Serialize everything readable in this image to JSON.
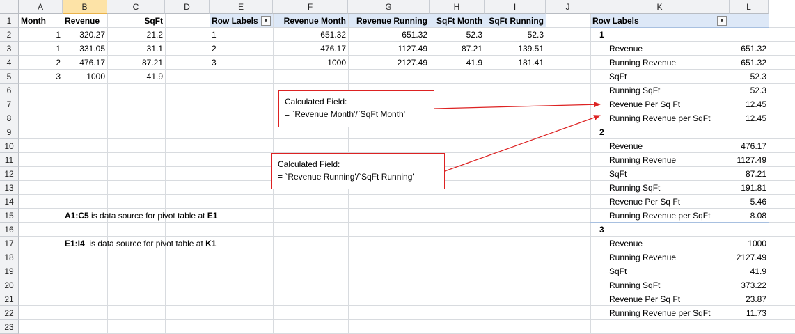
{
  "columns": [
    "A",
    "B",
    "C",
    "D",
    "E",
    "F",
    "G",
    "H",
    "I",
    "J",
    "K",
    "L"
  ],
  "rows": [
    "1",
    "2",
    "3",
    "4",
    "5",
    "6",
    "7",
    "8",
    "9",
    "10",
    "11",
    "12",
    "13",
    "14",
    "15",
    "16",
    "17",
    "18",
    "19",
    "20",
    "21",
    "22",
    "23"
  ],
  "source": {
    "headers": [
      "Month",
      "Revenue",
      "SqFt"
    ],
    "data": [
      [
        "1",
        "320.27",
        "21.2"
      ],
      [
        "1",
        "331.05",
        "31.1"
      ],
      [
        "2",
        "476.17",
        "87.21"
      ],
      [
        "3",
        "1000",
        "41.9"
      ]
    ]
  },
  "pivot1": {
    "headers": [
      "Row Labels",
      "Revenue Month",
      "Revenue Running",
      "SqFt Month",
      "SqFt Running"
    ],
    "dropdown_icon": "filter-dropdown-icon",
    "data": [
      [
        "1",
        "651.32",
        "651.32",
        "52.3",
        "52.3"
      ],
      [
        "2",
        "476.17",
        "1127.49",
        "87.21",
        "139.51"
      ],
      [
        "3",
        "1000",
        "2127.49",
        "41.9",
        "181.41"
      ]
    ]
  },
  "pivot2": {
    "header": "Row Labels",
    "dropdown_icon": "filter-dropdown-icon",
    "groups": [
      {
        "label": "1",
        "items": [
          [
            "Revenue",
            "651.32"
          ],
          [
            "Running Revenue",
            "651.32"
          ],
          [
            "SqFt",
            "52.3"
          ],
          [
            "Running SqFt",
            "52.3"
          ],
          [
            "Revenue Per Sq Ft",
            "12.45"
          ],
          [
            "Running Revenue per SqFt",
            "12.45"
          ]
        ]
      },
      {
        "label": "2",
        "items": [
          [
            "Revenue",
            "476.17"
          ],
          [
            "Running Revenue",
            "1127.49"
          ],
          [
            "SqFt",
            "87.21"
          ],
          [
            "Running SqFt",
            "191.81"
          ],
          [
            "Revenue Per Sq Ft",
            "5.46"
          ],
          [
            "Running Revenue per SqFt",
            "8.08"
          ]
        ]
      },
      {
        "label": "3",
        "items": [
          [
            "Revenue",
            "1000"
          ],
          [
            "Running Revenue",
            "2127.49"
          ],
          [
            "SqFt",
            "41.9"
          ],
          [
            "Running SqFt",
            "373.22"
          ],
          [
            "Revenue Per Sq Ft",
            "23.87"
          ],
          [
            "Running Revenue per SqFt",
            "11.73"
          ]
        ]
      }
    ]
  },
  "notes": {
    "note1": {
      "range": "A1:C5",
      "mid": " is data source for pivot table at ",
      "target": "E1"
    },
    "note2": {
      "range": "E1:I4",
      "mid": "  is data source for pivot table at ",
      "target": "K1"
    }
  },
  "callouts": {
    "c1": {
      "line1": "Calculated Field:",
      "line2": "= `Revenue Month'/`SqFt Month'"
    },
    "c2": {
      "line1": "Calculated Field:",
      "line2": "= `Revenue  Running'/`SqFt Running'"
    }
  },
  "colors": {
    "arrow": "#dd2222",
    "pivot_header": "#dde8f7",
    "selected_col": "#fde3a7"
  }
}
